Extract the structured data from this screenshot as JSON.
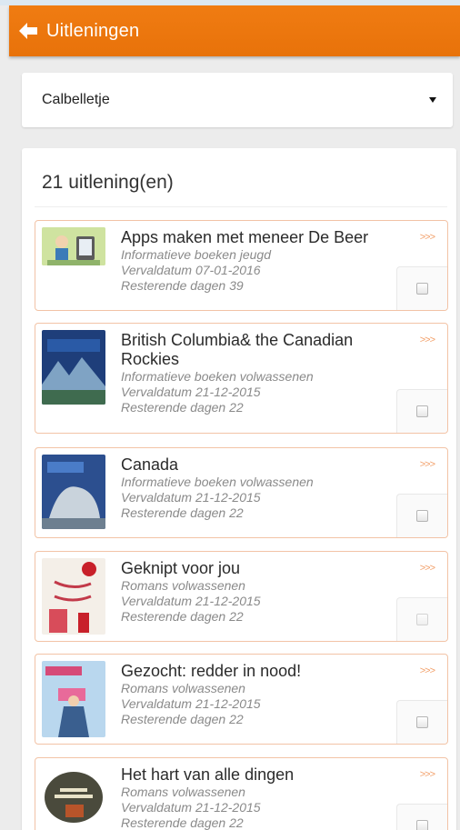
{
  "appbar": {
    "title": "Uitleningen",
    "back_icon": "arrow-left-icon",
    "color": "#f07c12"
  },
  "account_select": {
    "value": "Calbelletje"
  },
  "loans_count": "21 uitlening(en)",
  "loans": [
    {
      "title": "Apps maken met meneer De Beer",
      "category": "Informatieve boeken jeugd",
      "due": "Vervaldatum 07-01-2016",
      "remaining": "Resterende dagen 39",
      "more": ">>>"
    },
    {
      "title": "British Columbia& the Canadian Rockies",
      "category": "Informatieve boeken volwassenen",
      "due": "Vervaldatum 21-12-2015",
      "remaining": "Resterende dagen 22",
      "more": ">>>"
    },
    {
      "title": "Canada",
      "category": "Informatieve boeken volwassenen",
      "due": "Vervaldatum 21-12-2015",
      "remaining": "Resterende dagen 22",
      "more": ">>>"
    },
    {
      "title": "Geknipt voor jou",
      "category": "Romans volwassenen",
      "due": "Vervaldatum 21-12-2015",
      "remaining": "Resterende dagen 22",
      "more": ">>>"
    },
    {
      "title": "Gezocht: redder in nood!",
      "category": "Romans volwassenen",
      "due": "Vervaldatum 21-12-2015",
      "remaining": "Resterende dagen 22",
      "more": ">>>"
    },
    {
      "title": "Het hart van alle dingen",
      "category": "Romans volwassenen",
      "due": "Vervaldatum 21-12-2015",
      "remaining": "Resterende dagen 22",
      "more": ">>>"
    }
  ]
}
